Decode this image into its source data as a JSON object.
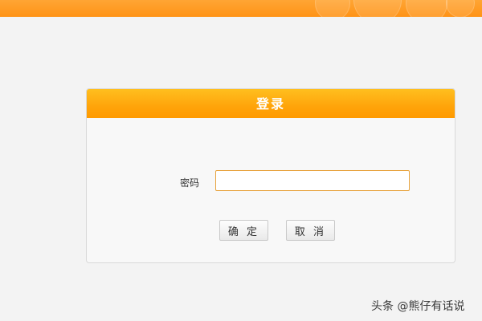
{
  "header": {
    "accent_color": "#ff9a1a"
  },
  "login_dialog": {
    "title": "登录",
    "password_label": "密码",
    "password_value": "",
    "confirm_label": "确 定",
    "cancel_label": "取 消",
    "header_color": "#ffa40a"
  },
  "watermark": {
    "text": "头条 @熊仔有话说"
  }
}
